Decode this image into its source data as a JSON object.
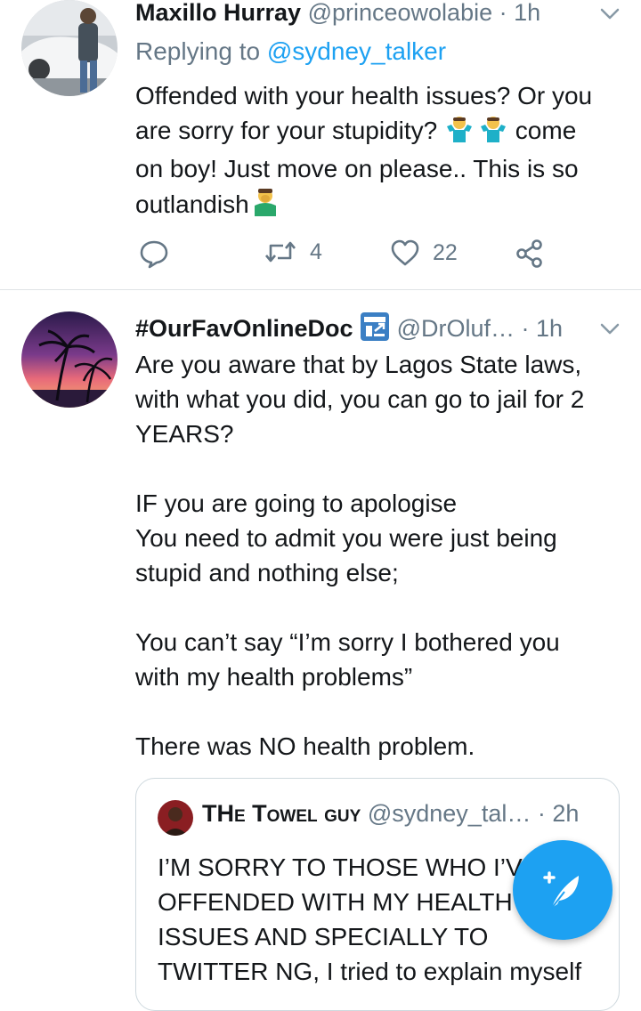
{
  "tweet1": {
    "name": "Maxillo Hurray",
    "handle": "@princeowolabie",
    "time": "· 1h",
    "replying_prefix": "Replying to ",
    "replying_handle": "@sydney_talker",
    "body_line1": "Offended with your health issues? Or you",
    "body_line2a": "are sorry for your stupidity? ",
    "body_line2b": " come",
    "body_line3": "on boy! Just move on please.. This is so",
    "body_line4": "outlandish",
    "emoji_shrug": "shrugging-emoji",
    "emoji_facepalm": "facepalm-emoji",
    "retweets": "4",
    "likes": "22"
  },
  "tweet2": {
    "name": "#OurFavOnlineDoc",
    "handle": "@DrOluf…",
    "time": "· 1h",
    "body": "Are you aware that by Lagos State laws,\nwith what you did, you can go to jail for 2\nYEARS?\n\nIF you are going to apologise\nYou need to admit you were just being\nstupid and nothing else;\n\nYou can’t say “I’m sorry I bothered you\nwith my health problems”\n\nThere was NO health problem.",
    "badge_icon": "medical-badge-icon"
  },
  "quote": {
    "name": "THe Towel guy",
    "handle": "@sydney_tal…",
    "time": "· 2h",
    "body": "I’M SORRY TO THOSE WHO I’VE\nOFFENDED WITH MY HEALTH\nISSUES AND SPECIALLY TO\nTWITTER NG, I tried to explain myself"
  },
  "colors": {
    "accent": "#1da1f2",
    "secondary_text": "#657786",
    "divider": "#dfe3e6"
  }
}
